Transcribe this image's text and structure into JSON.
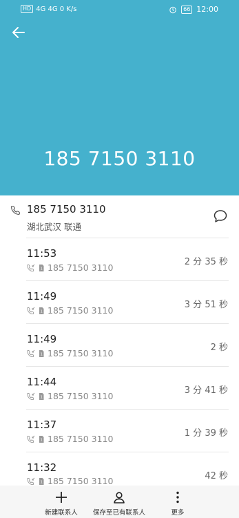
{
  "status_bar": {
    "left": "4G 4G 0 K/s",
    "battery": "66",
    "time": "12:00"
  },
  "header": {
    "number": "185 7150 3110"
  },
  "summary": {
    "number": "185 7150 3110",
    "location": "湖北武汉 联通"
  },
  "calls": [
    {
      "time": "11:53",
      "number": "185 7150 3110",
      "duration": "2 分 35 秒"
    },
    {
      "time": "11:49",
      "number": "185 7150 3110",
      "duration": "3 分 51 秒"
    },
    {
      "time": "11:49",
      "number": "185 7150 3110",
      "duration": "2 秒"
    },
    {
      "time": "11:44",
      "number": "185 7150 3110",
      "duration": "3 分 41 秒"
    },
    {
      "time": "11:37",
      "number": "185 7150 3110",
      "duration": "1 分 39 秒"
    },
    {
      "time": "11:32",
      "number": "185 7150 3110",
      "duration": "42 秒"
    }
  ],
  "bottom_bar": {
    "new_contact": "新建联系人",
    "save_existing": "保存至已有联系人",
    "more": "更多"
  },
  "colors": {
    "header_bg": "#45b1cd"
  },
  "icons": {
    "back": "back-arrow-icon",
    "phone": "phone-icon",
    "message": "message-icon",
    "add": "plus-icon",
    "person": "person-icon",
    "more": "more-vertical-icon"
  }
}
